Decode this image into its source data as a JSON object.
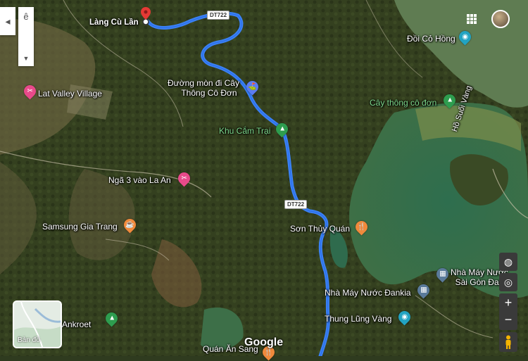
{
  "places": {
    "lang_cu_lan": "Làng Cù Lần",
    "lat_valley": "Lat Valley Village",
    "duong_mon_line1": "Đường mòn đi Cây",
    "duong_mon_line2": "Thông Cô Đơn",
    "khu_cam_trai": "Khu Cắm Trại",
    "nga3": "Ngã 3 vào La An",
    "samsung": "Samsung Gia Trang",
    "son_thuy": "Sơn Thủy Quán",
    "nha_may_dankia": "Nhà Máy Nước Đankia",
    "thung_lung_vang": "Thung Lũng Vàng",
    "quan_an": "Quán Ăn Sang",
    "ankroet": "Ankroet",
    "doi_co_hong": "Đồi Cỏ Hồng",
    "cay_thong": "Cây thông cô đơn",
    "ho_suoi_vang": "Hồ Suối Vàng",
    "nha_may_sg_line1": "Nhà Máy Nước",
    "nha_may_sg_line2": "Sài Gòn Đan"
  },
  "roads": {
    "dt722_a": "DT722",
    "dt722_b": "DT722"
  },
  "controls": {
    "layer_label": "Bản đồ",
    "google_logo": "Google",
    "zoom_in": "+",
    "zoom_out": "−"
  },
  "colors": {
    "route": "#3b82f6",
    "water": "#2f6e50",
    "water_light": "#8ea36a"
  },
  "icons": {
    "pin": "pin-icon",
    "apps": "apps-grid-icon",
    "pegman": "pegman-icon"
  }
}
